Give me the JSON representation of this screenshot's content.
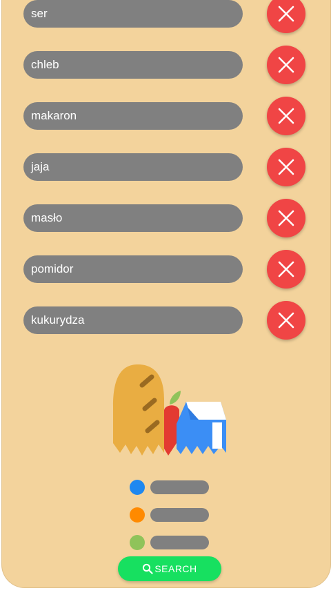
{
  "ingredients": [
    {
      "name": "ser"
    },
    {
      "name": "chleb"
    },
    {
      "name": "makaron"
    },
    {
      "name": "jaja"
    },
    {
      "name": "masło"
    },
    {
      "name": "pomidor"
    },
    {
      "name": "kukurydza"
    }
  ],
  "illustration": {
    "icon": "grocery-bag-icon"
  },
  "legend": [
    {
      "color": "#1e88f0"
    },
    {
      "color": "#ff8a00"
    },
    {
      "color": "#8fc35a"
    }
  ],
  "search": {
    "label": "SEARCH",
    "icon": "search-icon"
  },
  "colors": {
    "background": "#f3d39c",
    "pill": "#808080",
    "delete": "#f04545",
    "search": "#17e060"
  }
}
